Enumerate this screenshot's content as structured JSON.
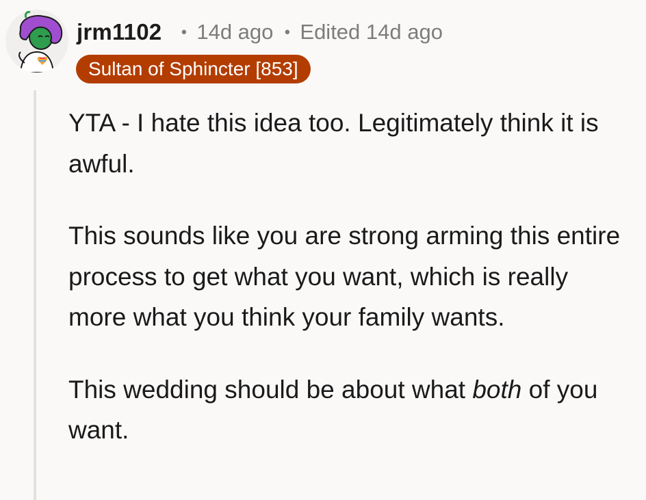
{
  "comment": {
    "username": "jrm1102",
    "separator": "•",
    "timestamp": "14d ago",
    "edited": "Edited 14d ago",
    "flair": "Sultan of Sphincter [853]",
    "paragraphs": {
      "p1": "YTA - I hate this idea too. Legitimately think it is awful.",
      "p2": "This sounds like you are strong arming this entire process to get what you want, which is really more what you think your family wants.",
      "p3_before": "This wedding should be about what ",
      "p3_emphasis": "both",
      "p3_after": " of you want."
    }
  },
  "colors": {
    "background": "#faf9f8",
    "flair_bg": "#b33d00",
    "meta": "#7c7c7c",
    "thread_line": "#e5e0dc",
    "avatar_hair": "#a04ecf",
    "avatar_skin": "#2f9d4e"
  },
  "icons": {
    "avatar": "snoo-avatar-icon",
    "shirt_heart": "rainbow-heart-icon"
  }
}
